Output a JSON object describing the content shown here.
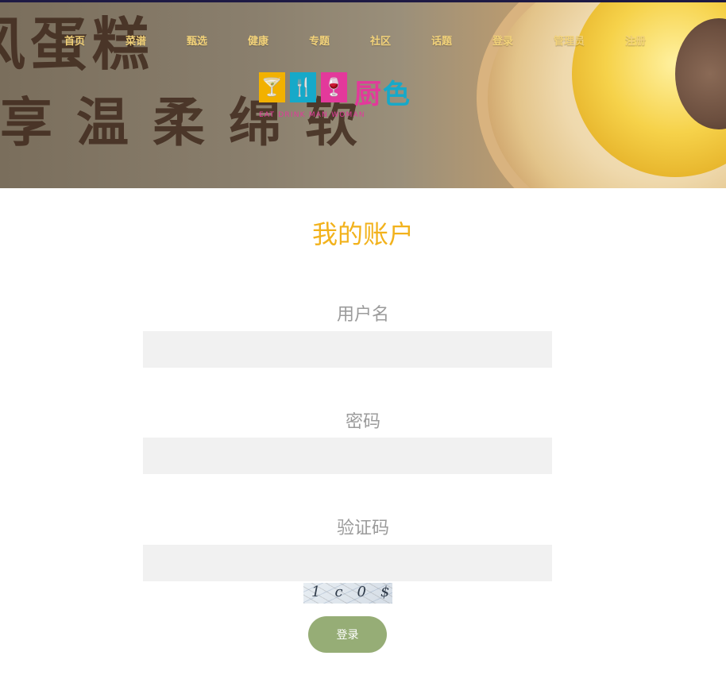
{
  "hero": {
    "background_text_line1": "风蛋糕",
    "background_text_line2": "享温柔绵软"
  },
  "nav": {
    "items": [
      "首页",
      "菜谱",
      "甄选",
      "健康",
      "专题",
      "社区",
      "话题",
      "登录",
      "管理员",
      "注册"
    ]
  },
  "logo": {
    "brand_part1": "厨",
    "brand_part2": "色",
    "tagline": "EAT DRINK MAN WOMAN"
  },
  "page": {
    "title": "我的账户"
  },
  "form": {
    "username_label": "用户名",
    "password_label": "密码",
    "captcha_label": "验证码",
    "captcha_text": "1c0$",
    "login_button": "登录"
  },
  "colors": {
    "title": "#f2b21c",
    "nav_text": "#f2d27a",
    "button": "#96ad76",
    "field_bg": "#f1f1f1",
    "label": "#9b9b9b"
  }
}
